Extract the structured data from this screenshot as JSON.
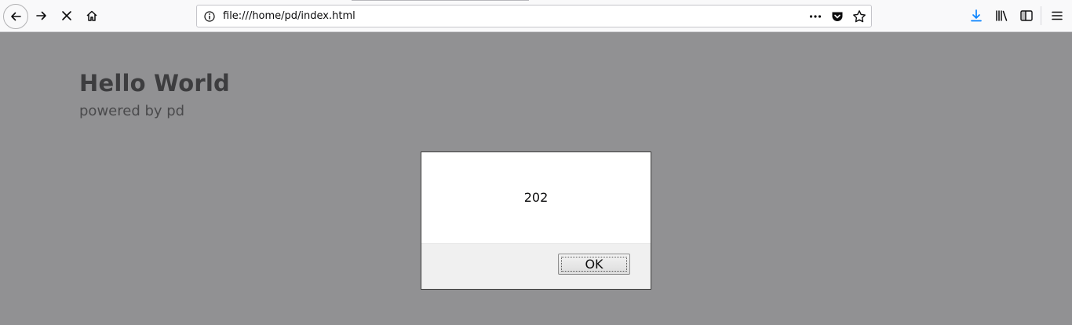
{
  "browser": {
    "url": "file:///home/pd/index.html",
    "accent_color": "#0a84ff"
  },
  "page": {
    "title": "Hello World",
    "subtitle": "powered by pd"
  },
  "dialog": {
    "message": "202",
    "ok_label": "OK"
  },
  "icons": {
    "back": "arrow-left-icon",
    "forward": "arrow-right-icon",
    "stop": "close-icon",
    "home": "home-icon",
    "info": "info-icon",
    "more": "ellipsis-icon",
    "pocket": "pocket-icon",
    "star": "star-icon",
    "download": "download-icon",
    "library": "library-icon",
    "sidebar": "sidebar-icon",
    "menu": "hamburger-menu-icon"
  }
}
